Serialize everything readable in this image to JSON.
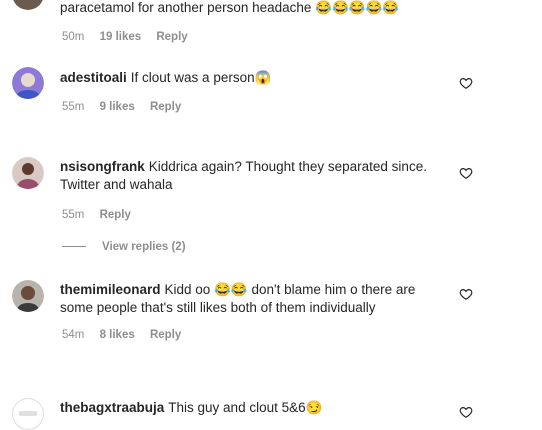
{
  "comments": [
    {
      "username": "",
      "text": "paracetamol for another person headache",
      "emoji_suffix": "😂😂😂😂😂",
      "time": "50m",
      "likes": "19 likes",
      "reply": "Reply"
    },
    {
      "username": "adestitoali",
      "text": "If clout was a person",
      "emoji_suffix": "😱",
      "time": "55m",
      "likes": "9 likes",
      "reply": "Reply"
    },
    {
      "username": "nsisongfrank",
      "text": "Kiddrica again? Thought they separated since. Twitter and wahala",
      "emoji_suffix": "",
      "time": "55m",
      "likes": "",
      "reply": "Reply"
    },
    {
      "username": "themimileonard",
      "text_before": "Kidd oo",
      "emoji_mid": "😂😂",
      "text_after": "don't blame him o there are some people that's still likes both of them individually",
      "time": "54m",
      "likes": "8 likes",
      "reply": "Reply"
    },
    {
      "username": "thebagxtraabuja",
      "text": "This guy and clout 5&6",
      "emoji_suffix": "😏"
    }
  ],
  "view_replies": "View replies (2)",
  "icons": {
    "like": "heart-outline-icon"
  },
  "colors": {
    "text": "#262626",
    "muted": "#8e8e8e",
    "background": "#ffffff"
  }
}
